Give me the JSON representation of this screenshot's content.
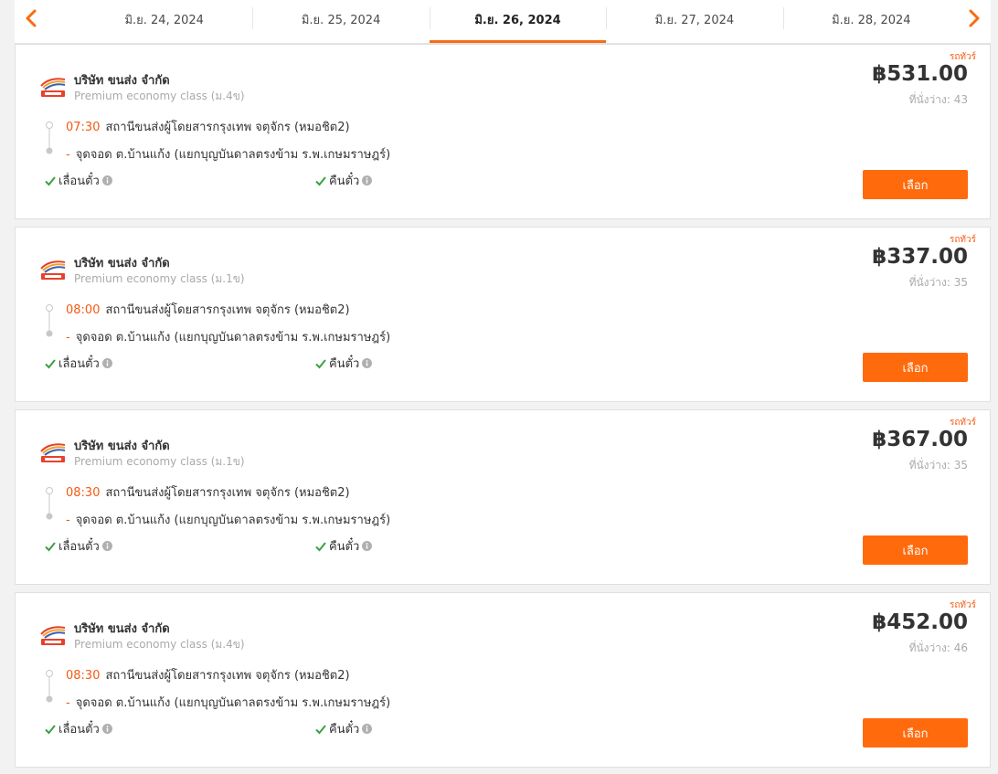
{
  "date_nav": {
    "prev_icon": "chevron-left-icon",
    "next_icon": "chevron-right-icon",
    "dates": [
      "มิ.ย. 24, 2024",
      "มิ.ย. 25, 2024",
      "มิ.ย. 26, 2024",
      "มิ.ย. 27, 2024",
      "มิ.ย. 28, 2024"
    ],
    "active_index": 2
  },
  "trips": [
    {
      "tag": "รถทัวร์",
      "company": "บริษัท ขนส่ง จำกัด",
      "bus_class": "Premium economy class (ม.4ข)",
      "departure_time": "07:30",
      "departure_station": "สถานีขนส่งผู้โดยสารกรุงเทพ จตุจักร (หมอชิต2)",
      "arrival_dash": "-",
      "arrival_station": "จุดจอด ต.บ้านแก้ง (แยกบุญบันดาลตรงข้าม ร.พ.เกษมราษฎร์)",
      "reschedule": "เลื่อนตั๋ว",
      "refund": "คืนตั๋ว",
      "price": "฿531.00",
      "seats": "ที่นั่งว่าง: 43",
      "select_label": "เลือก"
    },
    {
      "tag": "รถทัวร์",
      "company": "บริษัท ขนส่ง จำกัด",
      "bus_class": "Premium economy class (ม.1ข)",
      "departure_time": "08:00",
      "departure_station": "สถานีขนส่งผู้โดยสารกรุงเทพ จตุจักร (หมอชิต2)",
      "arrival_dash": "-",
      "arrival_station": "จุดจอด ต.บ้านแก้ง (แยกบุญบันดาลตรงข้าม ร.พ.เกษมราษฎร์)",
      "reschedule": "เลื่อนตั๋ว",
      "refund": "คืนตั๋ว",
      "price": "฿337.00",
      "seats": "ที่นั่งว่าง: 35",
      "select_label": "เลือก"
    },
    {
      "tag": "รถทัวร์",
      "company": "บริษัท ขนส่ง จำกัด",
      "bus_class": "Premium economy class (ม.1ข)",
      "departure_time": "08:30",
      "departure_station": "สถานีขนส่งผู้โดยสารกรุงเทพ จตุจักร (หมอชิต2)",
      "arrival_dash": "-",
      "arrival_station": "จุดจอด ต.บ้านแก้ง (แยกบุญบันดาลตรงข้าม ร.พ.เกษมราษฎร์)",
      "reschedule": "เลื่อนตั๋ว",
      "refund": "คืนตั๋ว",
      "price": "฿367.00",
      "seats": "ที่นั่งว่าง: 35",
      "select_label": "เลือก"
    },
    {
      "tag": "รถทัวร์",
      "company": "บริษัท ขนส่ง จำกัด",
      "bus_class": "Premium economy class (ม.4ข)",
      "departure_time": "08:30",
      "departure_station": "สถานีขนส่งผู้โดยสารกรุงเทพ จตุจักร (หมอชิต2)",
      "arrival_dash": "-",
      "arrival_station": "จุดจอด ต.บ้านแก้ง (แยกบุญบันดาลตรงข้าม ร.พ.เกษมราษฎร์)",
      "reschedule": "เลื่อนตั๋ว",
      "refund": "คืนตั๋ว",
      "price": "฿452.00",
      "seats": "ที่นั่งว่าง: 46",
      "select_label": "เลือก"
    }
  ],
  "colors": {
    "accent": "#ff6a0d",
    "accent_text": "#f55a10",
    "check": "#3aa141",
    "muted": "#aaaaaa"
  },
  "icons": {
    "check": "check-icon",
    "info": "info-icon",
    "logo": "bus-company-logo",
    "route": "route-line-icon"
  }
}
